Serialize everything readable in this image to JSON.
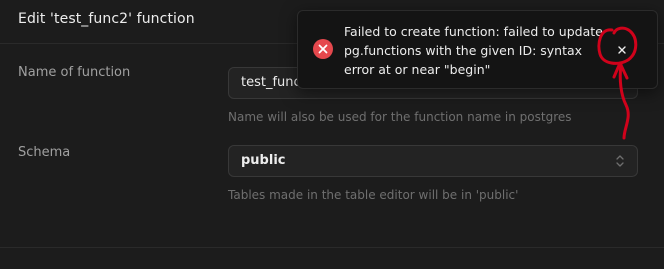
{
  "header": {
    "title": "Edit 'test_func2' function"
  },
  "form": {
    "name_field": {
      "label": "Name of function",
      "value": "test_func",
      "hint": "Name will also be used for the function name in postgres"
    },
    "schema_field": {
      "label": "Schema",
      "value": "public",
      "hint": "Tables made in the table editor will be in 'public'"
    }
  },
  "toast": {
    "message": "Failed to create function: failed to update pg.functions with the given ID: syntax error at or near \"begin\"",
    "icon": "error-circle-icon",
    "close_icon": "close-icon"
  },
  "colors": {
    "background": "#1c1c1c",
    "error": "#e5484d",
    "annotation": "#d0021b"
  }
}
